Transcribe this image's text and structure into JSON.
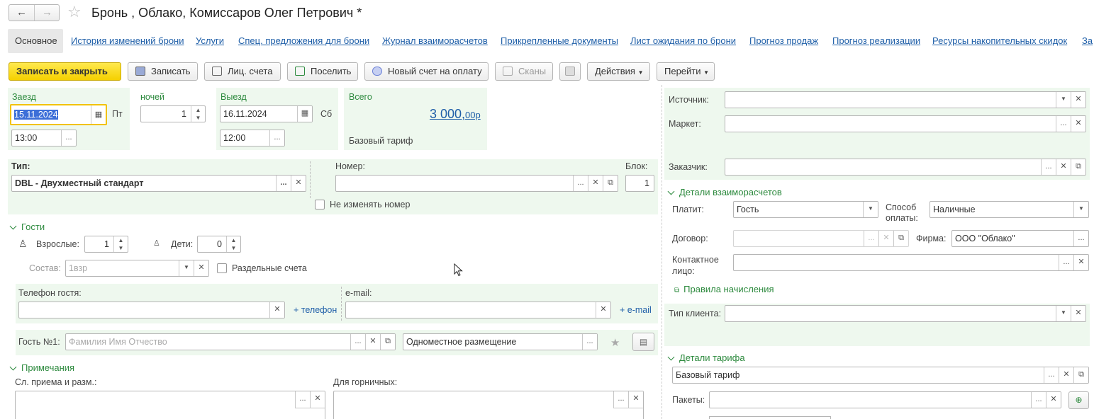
{
  "header": {
    "title": "Бронь , Облако, Комиссаров Олег Петрович *"
  },
  "tabs": [
    {
      "label": "Основное"
    },
    {
      "label": "История изменений брони"
    },
    {
      "label": "Услуги"
    },
    {
      "label": "Спец. предложения для брони"
    },
    {
      "label": "Журнал взаиморасчетов"
    },
    {
      "label": "Прикрепленные документы"
    },
    {
      "label": "Лист ожидания по брони"
    },
    {
      "label": "Прогноз продаж"
    },
    {
      "label": "Прогноз реализации"
    },
    {
      "label": "Ресурсы накопительных скидок"
    },
    {
      "label": "За"
    }
  ],
  "toolbar": {
    "save_close": "Записать и закрыть",
    "save": "Записать",
    "accounts": "Лиц. счета",
    "checkin": "Поселить",
    "new_invoice": "Новый счет на оплату",
    "scans": "Сканы",
    "actions": "Действия",
    "goto": "Перейти"
  },
  "stay": {
    "arrival_label": "Заезд",
    "arrival_date": "15.11.2024",
    "arrival_day": "Пт",
    "arrival_time": "13:00",
    "nights_label": "ночей",
    "nights": "1",
    "departure_label": "Выезд",
    "departure_date": "16.11.2024",
    "departure_day": "Сб",
    "departure_time": "12:00",
    "total_label": "Всего",
    "total_main": "3 000,",
    "total_cents": "00р",
    "tariff": "Базовый тариф"
  },
  "room": {
    "type_label": "Тип:",
    "type_value": "DBL - Двухместный стандарт",
    "number_label": "Номер:",
    "number_value": "",
    "block_label": "Блок:",
    "block_value": "1",
    "keep_number": "Не изменять номер"
  },
  "guests": {
    "section": "Гости",
    "adults_label": "Взрослые:",
    "adults": "1",
    "children_label": "Дети:",
    "children": "0",
    "composition_label": "Состав:",
    "composition_placeholder": "1взр",
    "separate_accounts": "Раздельные счета",
    "phone_label": "Телефон гостя:",
    "add_phone": "+ телефон",
    "email_label": "e-mail:",
    "add_email": "+ e-mail",
    "guest1_label": "Гость №1:",
    "guest1_placeholder": "Фамилия Имя Отчество",
    "accommodation": "Одноместное размещение"
  },
  "notes": {
    "section": "Примечания",
    "reception_label": "Сл. приема и разм.:",
    "housekeeping_label": "Для горничных:"
  },
  "right": {
    "source_label": "Источник:",
    "market_label": "Маркет:",
    "customer_label": "Заказчик:",
    "settlement_section": "Детали взаиморасчетов",
    "payer_label": "Платит:",
    "payer_value": "Гость",
    "payment_label_1": "Способ",
    "payment_label_2": "оплаты:",
    "payment_value": "Наличные",
    "contract_label": "Договор:",
    "firm_label": "Фирма:",
    "firm_value": "ООО \"Облако\"",
    "contact_label_1": "Контактное",
    "contact_label_2": "лицо:",
    "charge_rules": "Правила начисления",
    "client_type_label": "Тип клиента:",
    "tariff_section": "Детали тарифа",
    "tariff_value": "Базовый тариф",
    "packages_label": "Пакеты:"
  }
}
